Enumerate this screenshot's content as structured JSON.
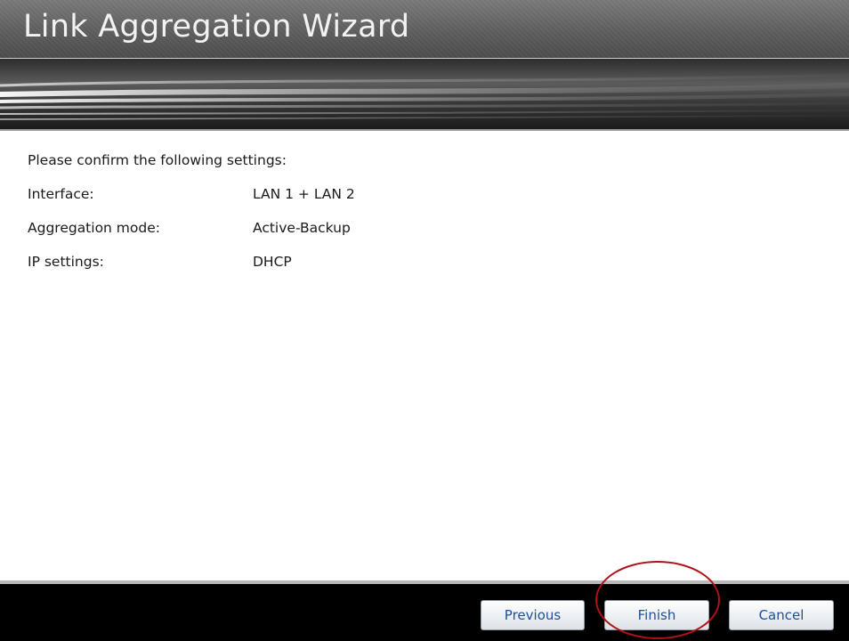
{
  "window": {
    "title": "Link Aggregation Wizard"
  },
  "content": {
    "prompt": "Please confirm the following settings:",
    "settings": [
      {
        "label": "Interface:",
        "value": "LAN 1 + LAN 2"
      },
      {
        "label": "Aggregation mode:",
        "value": "Active-Backup"
      },
      {
        "label": "IP settings:",
        "value": "DHCP"
      }
    ]
  },
  "footer": {
    "previous_label": "Previous",
    "finish_label": "Finish",
    "cancel_label": "Cancel"
  },
  "colors": {
    "button_text": "#1f4f98",
    "highlight_ring": "#b01016",
    "footer_background": "#000000"
  }
}
